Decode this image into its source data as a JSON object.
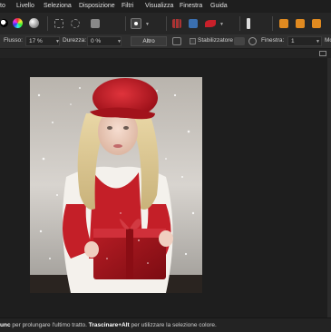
{
  "menu": {
    "items": [
      "to",
      "Livello",
      "Seleziona",
      "Disposizione",
      "Filtri",
      "Visualizza",
      "Finestra",
      "Guida"
    ]
  },
  "context_bar": {
    "flow_label": "Flusso:",
    "flow_value": "17 %",
    "hardness_label": "Durezza:",
    "hardness_value": "0 %",
    "more_button": "Altro",
    "stabilizer_label": "Stabilizzatore",
    "window_label": "Finestra:",
    "window_value": "1",
    "mode_label": "Mo"
  },
  "status": {
    "key1": "unc",
    "text1": " per prolungare l'ultimo tratto. ",
    "key2": "Trascinare+Alt",
    "text2": " per utilizzare la selezione colore."
  },
  "colors": {
    "background": "#2b2b2b",
    "canvas": "#1e1e1e",
    "accent_red": "#c8202a",
    "accent_orange": "#e08a20"
  }
}
